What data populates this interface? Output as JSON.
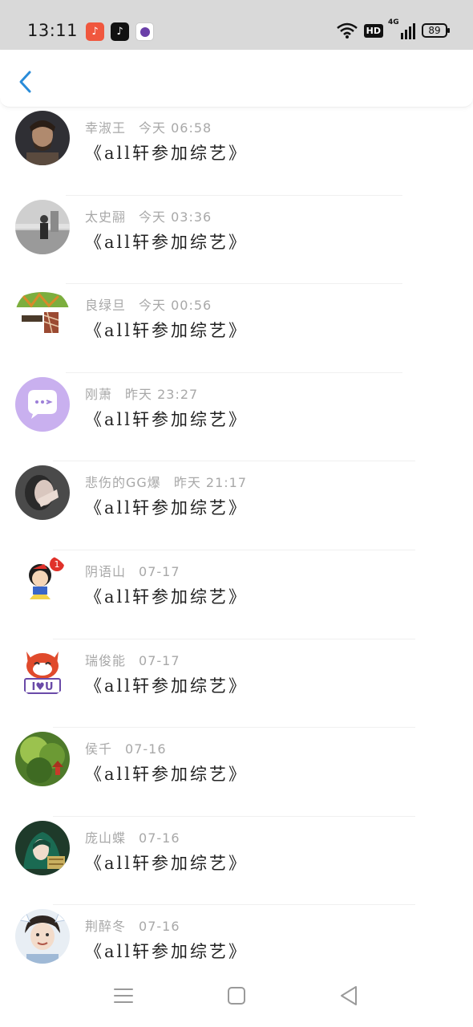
{
  "status_bar": {
    "time": "13:11",
    "apps": [
      "music-app-icon",
      "tiktok-app-icon",
      "third-app-icon"
    ],
    "network_label": "4G",
    "hd_label": "HD",
    "battery": "89"
  },
  "header": {
    "back_icon": "chevron-left-icon",
    "accent": "#2a8cd9"
  },
  "messages": [
    {
      "name": "幸淑王",
      "when": "今天 06:58",
      "title": "《all轩参加综艺》"
    },
    {
      "name": "太史翮",
      "when": "今天 03:36",
      "title": "《all轩参加综艺》"
    },
    {
      "name": "良绿旦",
      "when": "今天 00:56",
      "title": "《all轩参加综艺》"
    },
    {
      "name": "刚萧",
      "when": "昨天 23:27",
      "title": "《all轩参加综艺》"
    },
    {
      "name": "悲伤的GG爆",
      "when": "昨天 21:17",
      "title": "《all轩参加综艺》"
    },
    {
      "name": "阴语山",
      "when": "07-17",
      "title": "《all轩参加综艺》"
    },
    {
      "name": "瑞俊能",
      "when": "07-17",
      "title": "《all轩参加综艺》"
    },
    {
      "name": "侯千",
      "when": "07-16",
      "title": "《all轩参加综艺》"
    },
    {
      "name": "庞山蝶",
      "when": "07-16",
      "title": "《all轩参加综艺》"
    },
    {
      "name": "荆醉冬",
      "when": "07-16",
      "title": "《all轩参加综艺》"
    }
  ],
  "avatar_badge": "1",
  "avatar_sticker_text": "I♥U",
  "nav": [
    "menu-icon",
    "home-square-icon",
    "back-triangle-icon"
  ]
}
